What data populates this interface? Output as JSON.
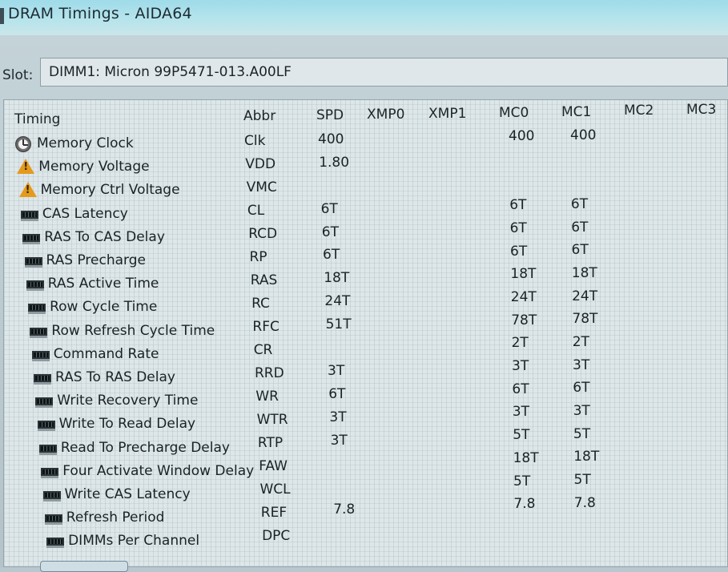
{
  "window": {
    "title": "DRAM Timings - AIDA64"
  },
  "slot": {
    "label": "Slot:",
    "value": "DIMM1: Micron 99P5471-013.A00LF"
  },
  "table": {
    "headers": {
      "timing": "Timing",
      "abbr": "Abbr",
      "spd": "SPD",
      "xmp0": "XMP0",
      "xmp1": "XMP1",
      "mc0": "MC0",
      "mc1": "MC1",
      "mc2": "MC2",
      "mc3": "MC3"
    },
    "rows": [
      {
        "icon": "clock-icon",
        "name": "Memory Clock",
        "abbr": "Clk",
        "spd": "400",
        "mc0": "400",
        "mc1": "400"
      },
      {
        "icon": "warning-icon",
        "name": "Memory Voltage",
        "abbr": "VDD",
        "spd": "1.80",
        "mc0": "",
        "mc1": ""
      },
      {
        "icon": "warning-icon",
        "name": "Memory Ctrl Voltage",
        "abbr": "VMC",
        "spd": "",
        "mc0": "",
        "mc1": ""
      },
      {
        "icon": "memory-module-icon",
        "name": "CAS Latency",
        "abbr": "CL",
        "spd": "6T",
        "mc0": "6T",
        "mc1": "6T"
      },
      {
        "icon": "memory-module-icon",
        "name": "RAS To CAS Delay",
        "abbr": "RCD",
        "spd": "6T",
        "mc0": "6T",
        "mc1": "6T"
      },
      {
        "icon": "memory-module-icon",
        "name": "RAS Precharge",
        "abbr": "RP",
        "spd": "6T",
        "mc0": "6T",
        "mc1": "6T"
      },
      {
        "icon": "memory-module-icon",
        "name": "RAS Active Time",
        "abbr": "RAS",
        "spd": "18T",
        "mc0": "18T",
        "mc1": "18T"
      },
      {
        "icon": "memory-module-icon",
        "name": "Row Cycle Time",
        "abbr": "RC",
        "spd": "24T",
        "mc0": "24T",
        "mc1": "24T"
      },
      {
        "icon": "memory-module-icon",
        "name": "Row Refresh Cycle Time",
        "abbr": "RFC",
        "spd": "51T",
        "mc0": "78T",
        "mc1": "78T"
      },
      {
        "icon": "memory-module-icon",
        "name": "Command Rate",
        "abbr": "CR",
        "spd": "",
        "mc0": "2T",
        "mc1": "2T"
      },
      {
        "icon": "memory-module-icon",
        "name": "RAS To RAS Delay",
        "abbr": "RRD",
        "spd": "3T",
        "mc0": "3T",
        "mc1": "3T"
      },
      {
        "icon": "memory-module-icon",
        "name": "Write Recovery Time",
        "abbr": "WR",
        "spd": "6T",
        "mc0": "6T",
        "mc1": "6T"
      },
      {
        "icon": "memory-module-icon",
        "name": "Write To Read Delay",
        "abbr": "WTR",
        "spd": "3T",
        "mc0": "3T",
        "mc1": "3T"
      },
      {
        "icon": "memory-module-icon",
        "name": "Read To Precharge Delay",
        "abbr": "RTP",
        "spd": "3T",
        "mc0": "5T",
        "mc1": "5T"
      },
      {
        "icon": "memory-module-icon",
        "name": "Four Activate Window Delay",
        "abbr": "FAW",
        "spd": "",
        "mc0": "18T",
        "mc1": "18T"
      },
      {
        "icon": "memory-module-icon",
        "name": "Write CAS Latency",
        "abbr": "WCL",
        "spd": "",
        "mc0": "5T",
        "mc1": "5T"
      },
      {
        "icon": "memory-module-icon",
        "name": "Refresh Period",
        "abbr": "REF",
        "spd": "7.8",
        "mc0": "7.8",
        "mc1": "7.8"
      },
      {
        "icon": "memory-module-icon",
        "name": "DIMMs Per Channel",
        "abbr": "DPC",
        "spd": "",
        "mc0": "",
        "mc1": ""
      }
    ]
  }
}
